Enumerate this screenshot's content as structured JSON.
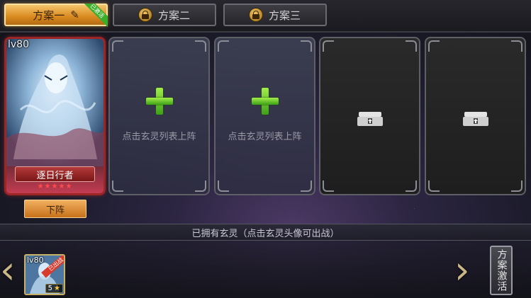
{
  "tabs": [
    {
      "label": "方案一",
      "state": "active",
      "icon": "edit-icon",
      "badge": "已激活"
    },
    {
      "label": "方案二",
      "state": "locked",
      "icon": "lock-icon"
    },
    {
      "label": "方案三",
      "state": "locked",
      "icon": "lock-icon"
    }
  ],
  "hero_slot": {
    "level": "lv80",
    "name": "逐日行者",
    "stars": "★★★★★",
    "remove_label": "下阵"
  },
  "empty_slots": [
    {
      "hint": "点击玄灵列表上阵",
      "icon": "plus-icon"
    },
    {
      "hint": "点击玄灵列表上阵",
      "icon": "plus-icon"
    }
  ],
  "locked_slots": [
    {
      "icon": "chest-unlock-icon"
    },
    {
      "icon": "chest-unlock-icon"
    }
  ],
  "owned": {
    "title": "已拥有玄灵（点击玄灵头像可出战）",
    "cards": [
      {
        "level": "lv80",
        "badge": "已出战",
        "star_count": "5",
        "star_icon": "★"
      }
    ]
  },
  "nav": {
    "prev": "‹",
    "next": "›"
  },
  "activate_label": "方案激活",
  "colors": {
    "accent": "#e09a2c",
    "hero_frame": "#9c2525",
    "plus_green": "#5fd12a"
  }
}
